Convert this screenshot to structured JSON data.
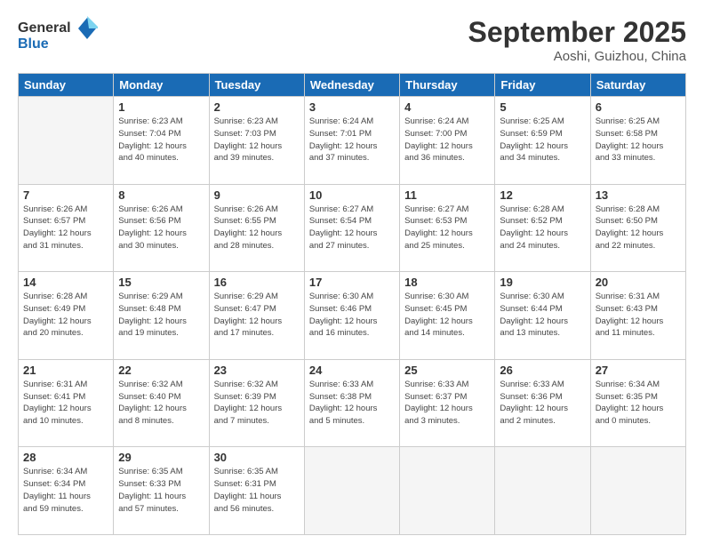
{
  "header": {
    "logo_general": "General",
    "logo_blue": "Blue",
    "month_title": "September 2025",
    "location": "Aoshi, Guizhou, China"
  },
  "days_of_week": [
    "Sunday",
    "Monday",
    "Tuesday",
    "Wednesday",
    "Thursday",
    "Friday",
    "Saturday"
  ],
  "weeks": [
    [
      {
        "day": "",
        "info": ""
      },
      {
        "day": "1",
        "info": "Sunrise: 6:23 AM\nSunset: 7:04 PM\nDaylight: 12 hours\nand 40 minutes."
      },
      {
        "day": "2",
        "info": "Sunrise: 6:23 AM\nSunset: 7:03 PM\nDaylight: 12 hours\nand 39 minutes."
      },
      {
        "day": "3",
        "info": "Sunrise: 6:24 AM\nSunset: 7:01 PM\nDaylight: 12 hours\nand 37 minutes."
      },
      {
        "day": "4",
        "info": "Sunrise: 6:24 AM\nSunset: 7:00 PM\nDaylight: 12 hours\nand 36 minutes."
      },
      {
        "day": "5",
        "info": "Sunrise: 6:25 AM\nSunset: 6:59 PM\nDaylight: 12 hours\nand 34 minutes."
      },
      {
        "day": "6",
        "info": "Sunrise: 6:25 AM\nSunset: 6:58 PM\nDaylight: 12 hours\nand 33 minutes."
      }
    ],
    [
      {
        "day": "7",
        "info": "Sunrise: 6:26 AM\nSunset: 6:57 PM\nDaylight: 12 hours\nand 31 minutes."
      },
      {
        "day": "8",
        "info": "Sunrise: 6:26 AM\nSunset: 6:56 PM\nDaylight: 12 hours\nand 30 minutes."
      },
      {
        "day": "9",
        "info": "Sunrise: 6:26 AM\nSunset: 6:55 PM\nDaylight: 12 hours\nand 28 minutes."
      },
      {
        "day": "10",
        "info": "Sunrise: 6:27 AM\nSunset: 6:54 PM\nDaylight: 12 hours\nand 27 minutes."
      },
      {
        "day": "11",
        "info": "Sunrise: 6:27 AM\nSunset: 6:53 PM\nDaylight: 12 hours\nand 25 minutes."
      },
      {
        "day": "12",
        "info": "Sunrise: 6:28 AM\nSunset: 6:52 PM\nDaylight: 12 hours\nand 24 minutes."
      },
      {
        "day": "13",
        "info": "Sunrise: 6:28 AM\nSunset: 6:50 PM\nDaylight: 12 hours\nand 22 minutes."
      }
    ],
    [
      {
        "day": "14",
        "info": "Sunrise: 6:28 AM\nSunset: 6:49 PM\nDaylight: 12 hours\nand 20 minutes."
      },
      {
        "day": "15",
        "info": "Sunrise: 6:29 AM\nSunset: 6:48 PM\nDaylight: 12 hours\nand 19 minutes."
      },
      {
        "day": "16",
        "info": "Sunrise: 6:29 AM\nSunset: 6:47 PM\nDaylight: 12 hours\nand 17 minutes."
      },
      {
        "day": "17",
        "info": "Sunrise: 6:30 AM\nSunset: 6:46 PM\nDaylight: 12 hours\nand 16 minutes."
      },
      {
        "day": "18",
        "info": "Sunrise: 6:30 AM\nSunset: 6:45 PM\nDaylight: 12 hours\nand 14 minutes."
      },
      {
        "day": "19",
        "info": "Sunrise: 6:30 AM\nSunset: 6:44 PM\nDaylight: 12 hours\nand 13 minutes."
      },
      {
        "day": "20",
        "info": "Sunrise: 6:31 AM\nSunset: 6:43 PM\nDaylight: 12 hours\nand 11 minutes."
      }
    ],
    [
      {
        "day": "21",
        "info": "Sunrise: 6:31 AM\nSunset: 6:41 PM\nDaylight: 12 hours\nand 10 minutes."
      },
      {
        "day": "22",
        "info": "Sunrise: 6:32 AM\nSunset: 6:40 PM\nDaylight: 12 hours\nand 8 minutes."
      },
      {
        "day": "23",
        "info": "Sunrise: 6:32 AM\nSunset: 6:39 PM\nDaylight: 12 hours\nand 7 minutes."
      },
      {
        "day": "24",
        "info": "Sunrise: 6:33 AM\nSunset: 6:38 PM\nDaylight: 12 hours\nand 5 minutes."
      },
      {
        "day": "25",
        "info": "Sunrise: 6:33 AM\nSunset: 6:37 PM\nDaylight: 12 hours\nand 3 minutes."
      },
      {
        "day": "26",
        "info": "Sunrise: 6:33 AM\nSunset: 6:36 PM\nDaylight: 12 hours\nand 2 minutes."
      },
      {
        "day": "27",
        "info": "Sunrise: 6:34 AM\nSunset: 6:35 PM\nDaylight: 12 hours\nand 0 minutes."
      }
    ],
    [
      {
        "day": "28",
        "info": "Sunrise: 6:34 AM\nSunset: 6:34 PM\nDaylight: 11 hours\nand 59 minutes."
      },
      {
        "day": "29",
        "info": "Sunrise: 6:35 AM\nSunset: 6:33 PM\nDaylight: 11 hours\nand 57 minutes."
      },
      {
        "day": "30",
        "info": "Sunrise: 6:35 AM\nSunset: 6:31 PM\nDaylight: 11 hours\nand 56 minutes."
      },
      {
        "day": "",
        "info": ""
      },
      {
        "day": "",
        "info": ""
      },
      {
        "day": "",
        "info": ""
      },
      {
        "day": "",
        "info": ""
      }
    ]
  ]
}
